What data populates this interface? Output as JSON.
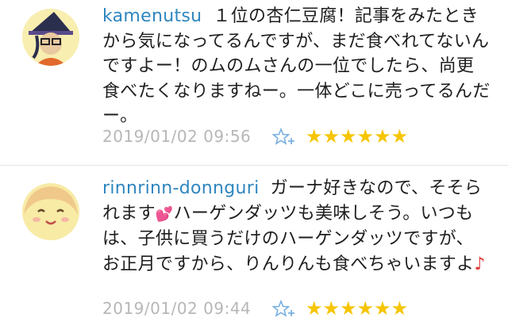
{
  "comments": [
    {
      "username": "kamenutsu",
      "body": "１位の杏仁豆腐！記事をみたときから気になってるんですが、まだ食べれてないんですよー！のムのムさんの一位でしたら、尚更食べたくなりますねー。一体どこに売ってるんだー。",
      "timestamp": "2019/01/02 09:56",
      "stars": "★★★★★★",
      "avatar_icon": "witch-hat-avatar-icon"
    },
    {
      "username": "rinnrinn-donnguri",
      "body_before_heart": "ガーナ好きなので、そそられます",
      "body_heart": "💕",
      "body_after_heart": "ハーゲンダッツも美味しそう。いつもは、子供に買うだけのハーゲンダッツですが、お正月ですから、りんりんも食べちゃいますよ",
      "body_note": "♪",
      "timestamp": "2019/01/02 09:44",
      "stars": "★★★★★★",
      "avatar_icon": "smiling-face-avatar-icon"
    }
  ],
  "colors": {
    "username": "#2f86bf",
    "star": "#f6c500",
    "timestamp": "#b7b7b7",
    "add_star_icon": "#7ab0e0"
  }
}
